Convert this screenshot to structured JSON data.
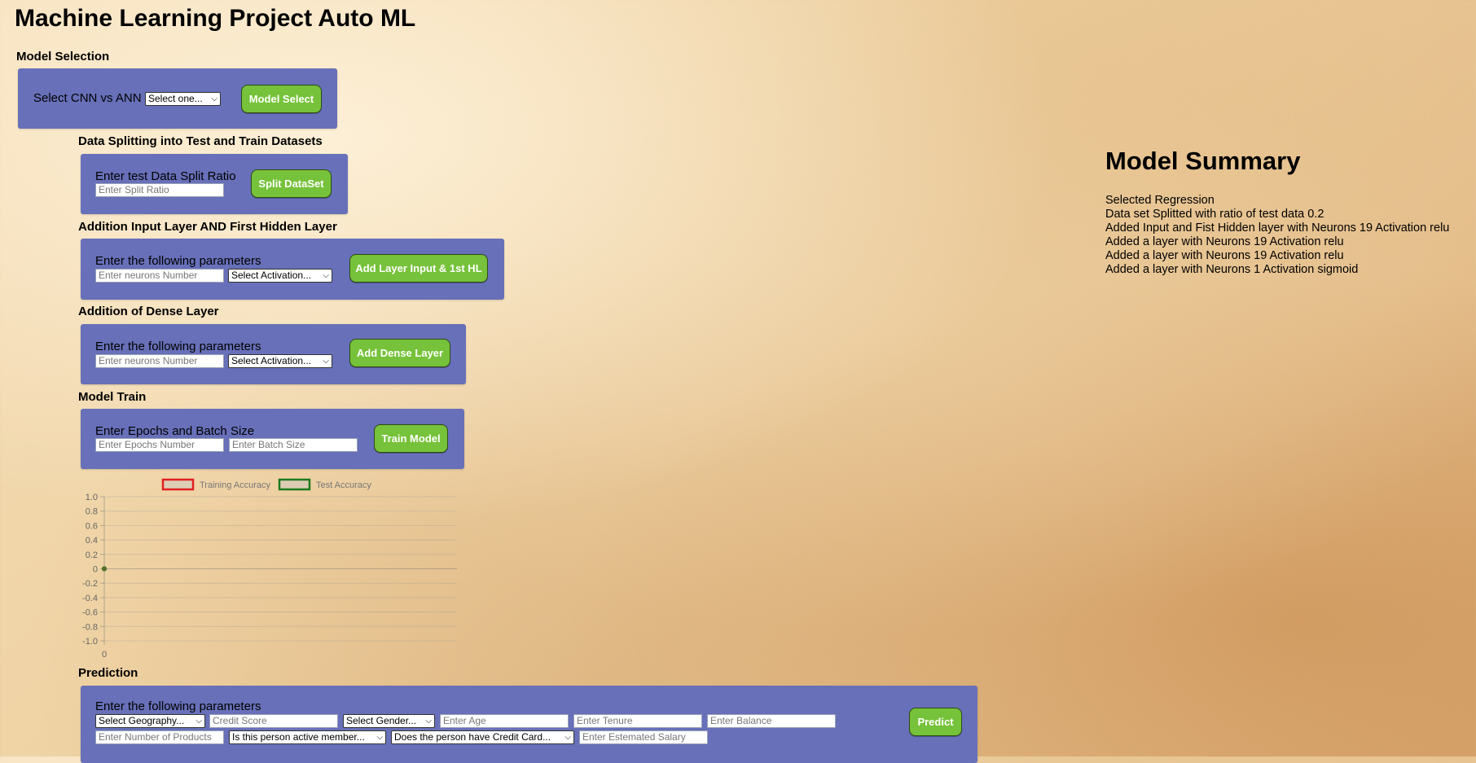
{
  "title": "Machine Learning Project Auto ML",
  "model_selection": {
    "label": "Model Selection",
    "prompt": "Select CNN vs ANN",
    "select_value": "Select one...",
    "button": "Model Select"
  },
  "split": {
    "label": "Data Splitting into Test and Train Datasets",
    "prompt": "Enter test Data Split Ratio",
    "input_placeholder": "Enter Split Ratio",
    "button": "Split DataSet"
  },
  "input_layer": {
    "label": "Addition Input Layer AND First Hidden Layer",
    "prompt": "Enter the following parameters",
    "neurons_placeholder": "Enter neurons Number",
    "activation_value": "Select Activation...",
    "button": "Add Layer Input & 1st HL"
  },
  "dense_layer": {
    "label": "Addition of Dense Layer",
    "prompt": "Enter the following parameters",
    "neurons_placeholder": "Enter neurons Number",
    "activation_value": "Select Activation...",
    "button": "Add Dense Layer"
  },
  "train": {
    "label": "Model Train",
    "prompt": "Enter Epochs and Batch Size",
    "epochs_placeholder": "Enter Epochs Number",
    "batch_placeholder": "Enter Batch Size",
    "button": "Train Model"
  },
  "chart_data": {
    "type": "line",
    "series": [
      {
        "name": "Training Accuracy",
        "color": "#e02020",
        "x": [
          0
        ],
        "values": [
          0
        ]
      },
      {
        "name": "Test Accuracy",
        "color": "#1e7a1e",
        "x": [
          0
        ],
        "values": [
          0
        ]
      }
    ],
    "legend": "top",
    "ylim": [
      -1.0,
      1.0
    ],
    "yticks": [
      "1.0",
      "0.8",
      "0.6",
      "0.4",
      "0.2",
      "0",
      "-0.2",
      "-0.4",
      "-0.6",
      "-0.8",
      "-1.0"
    ],
    "xticks": [
      "0"
    ],
    "grid": true,
    "title": "",
    "xlabel": "",
    "ylabel": ""
  },
  "prediction": {
    "label": "Prediction",
    "prompt": "Enter the following parameters",
    "geography_value": "Select Geography...",
    "credit_placeholder": "Credit Score",
    "gender_value": "Select Gender...",
    "age_placeholder": "Enter Age",
    "tenure_placeholder": "Enter Tenure",
    "balance_placeholder": "Enter Balance",
    "products_placeholder": "Enter Number of Products",
    "active_value": "Is this person active member...",
    "creditcard_value": "Does the person have Credit Card...",
    "salary_placeholder": "Enter Estemated Salary",
    "button": "Predict"
  },
  "summary": {
    "title": "Model Summary",
    "lines": [
      "Selected Regression",
      "Data set Splitted with ratio of test data 0.2",
      "Added Input and Fist Hidden layer with Neurons 19 Activation relu",
      "Added a layer with Neurons 19 Activation relu",
      "Added a layer with Neurons 19 Activation relu",
      "Added a layer with Neurons 1 Activation sigmoid"
    ]
  }
}
